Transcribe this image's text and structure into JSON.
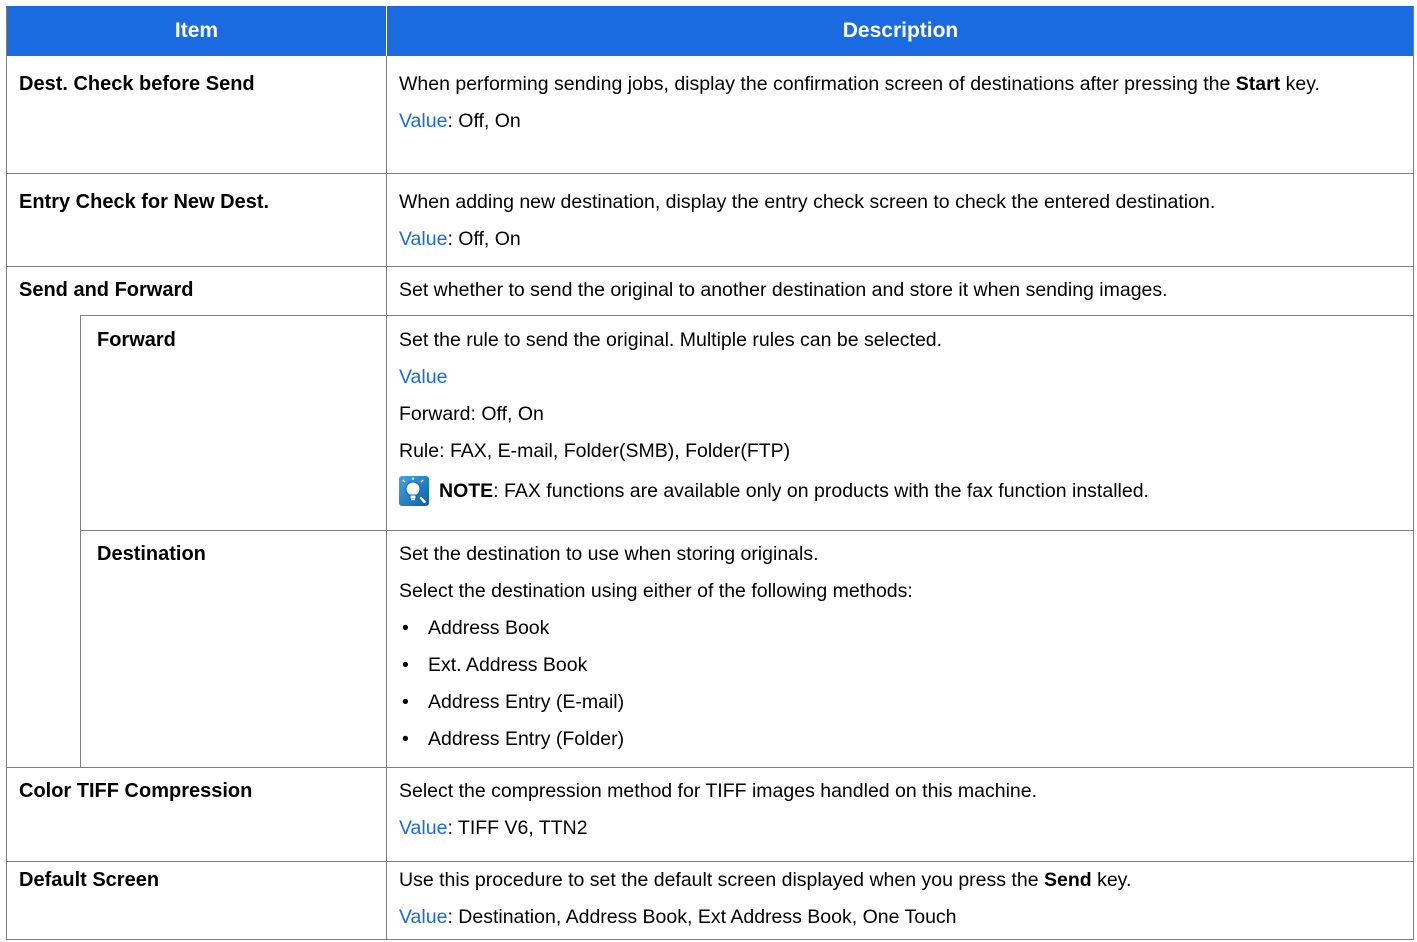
{
  "header": {
    "item": "Item",
    "description": "Description"
  },
  "rows": {
    "dest_check": {
      "item": "Dest. Check before Send",
      "desc_pre": "When performing sending jobs, display the confirmation screen of destinations after pressing the ",
      "desc_bold": "Start",
      "desc_post": " key.",
      "value_label": "Value",
      "value_text": ": Off, On"
    },
    "entry_check": {
      "item": "Entry Check for New Dest.",
      "desc": "When adding new destination, display the entry check screen to check the entered destination.",
      "value_label": "Value",
      "value_text": ": Off, On"
    },
    "send_forward": {
      "item": "Send and Forward",
      "desc": "Set whether to send the original to another destination and store it when sending images."
    },
    "forward": {
      "item": "Forward",
      "desc": "Set the rule to send the original. Multiple rules can be selected.",
      "value_label": "Value",
      "line1": "Forward: Off, On",
      "line2": "Rule: FAX, E-mail, Folder(SMB), Folder(FTP)",
      "note_bold": "NOTE",
      "note_text": ": FAX functions are available only on products with the fax function installed.",
      "note_icon": "note-icon"
    },
    "destination": {
      "item": "Destination",
      "desc1": "Set the destination to use when storing originals.",
      "desc2": "Select the destination using either of the following methods:",
      "bullets": [
        "Address Book",
        "Ext. Address Book",
        "Address Entry (E-mail)",
        "Address Entry (Folder)"
      ]
    },
    "color_tiff": {
      "item": "Color TIFF Compression",
      "desc": "Select the compression method for TIFF images handled on this machine.",
      "value_label": "Value",
      "value_text": ": TIFF V6, TTN2"
    },
    "default_screen": {
      "item": "Default Screen",
      "desc_pre": "Use this procedure to set the default screen displayed when you press the ",
      "desc_bold": "Send",
      "desc_post": " key.",
      "value_label": "Value",
      "value_text": ": Destination, Address Book, Ext Address Book, One Touch"
    }
  },
  "colors": {
    "header_bg": "#1a6be0",
    "value_text": "#1a6be0",
    "border": "#7f7f7f"
  }
}
